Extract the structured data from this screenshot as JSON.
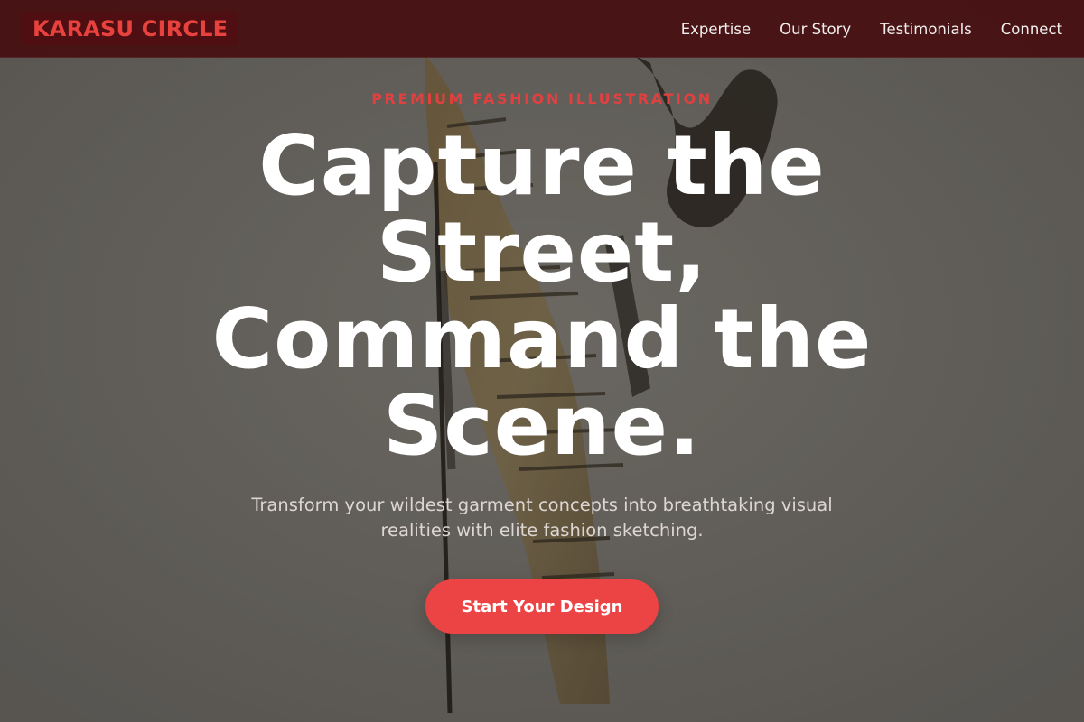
{
  "header": {
    "logo_text": "KARASU CIRCLE",
    "nav": [
      {
        "label": "Expertise"
      },
      {
        "label": "Our Story"
      },
      {
        "label": "Testimonials"
      },
      {
        "label": "Connect"
      }
    ]
  },
  "hero": {
    "eyebrow": "PREMIUM FASHION ILLUSTRATION",
    "headline": "Capture the Street, Command the Scene.",
    "subtitle": "Transform your wildest garment concepts into breathtaking visual realities with elite fashion sketching.",
    "cta_label": "Start Your Design"
  },
  "colors": {
    "accent": "#ec4345",
    "logo": "#e8423f",
    "header_bg": "#460a0c",
    "eyebrow": "#e0403f"
  },
  "background": {
    "icon": "fashion-sketch-illustration"
  }
}
